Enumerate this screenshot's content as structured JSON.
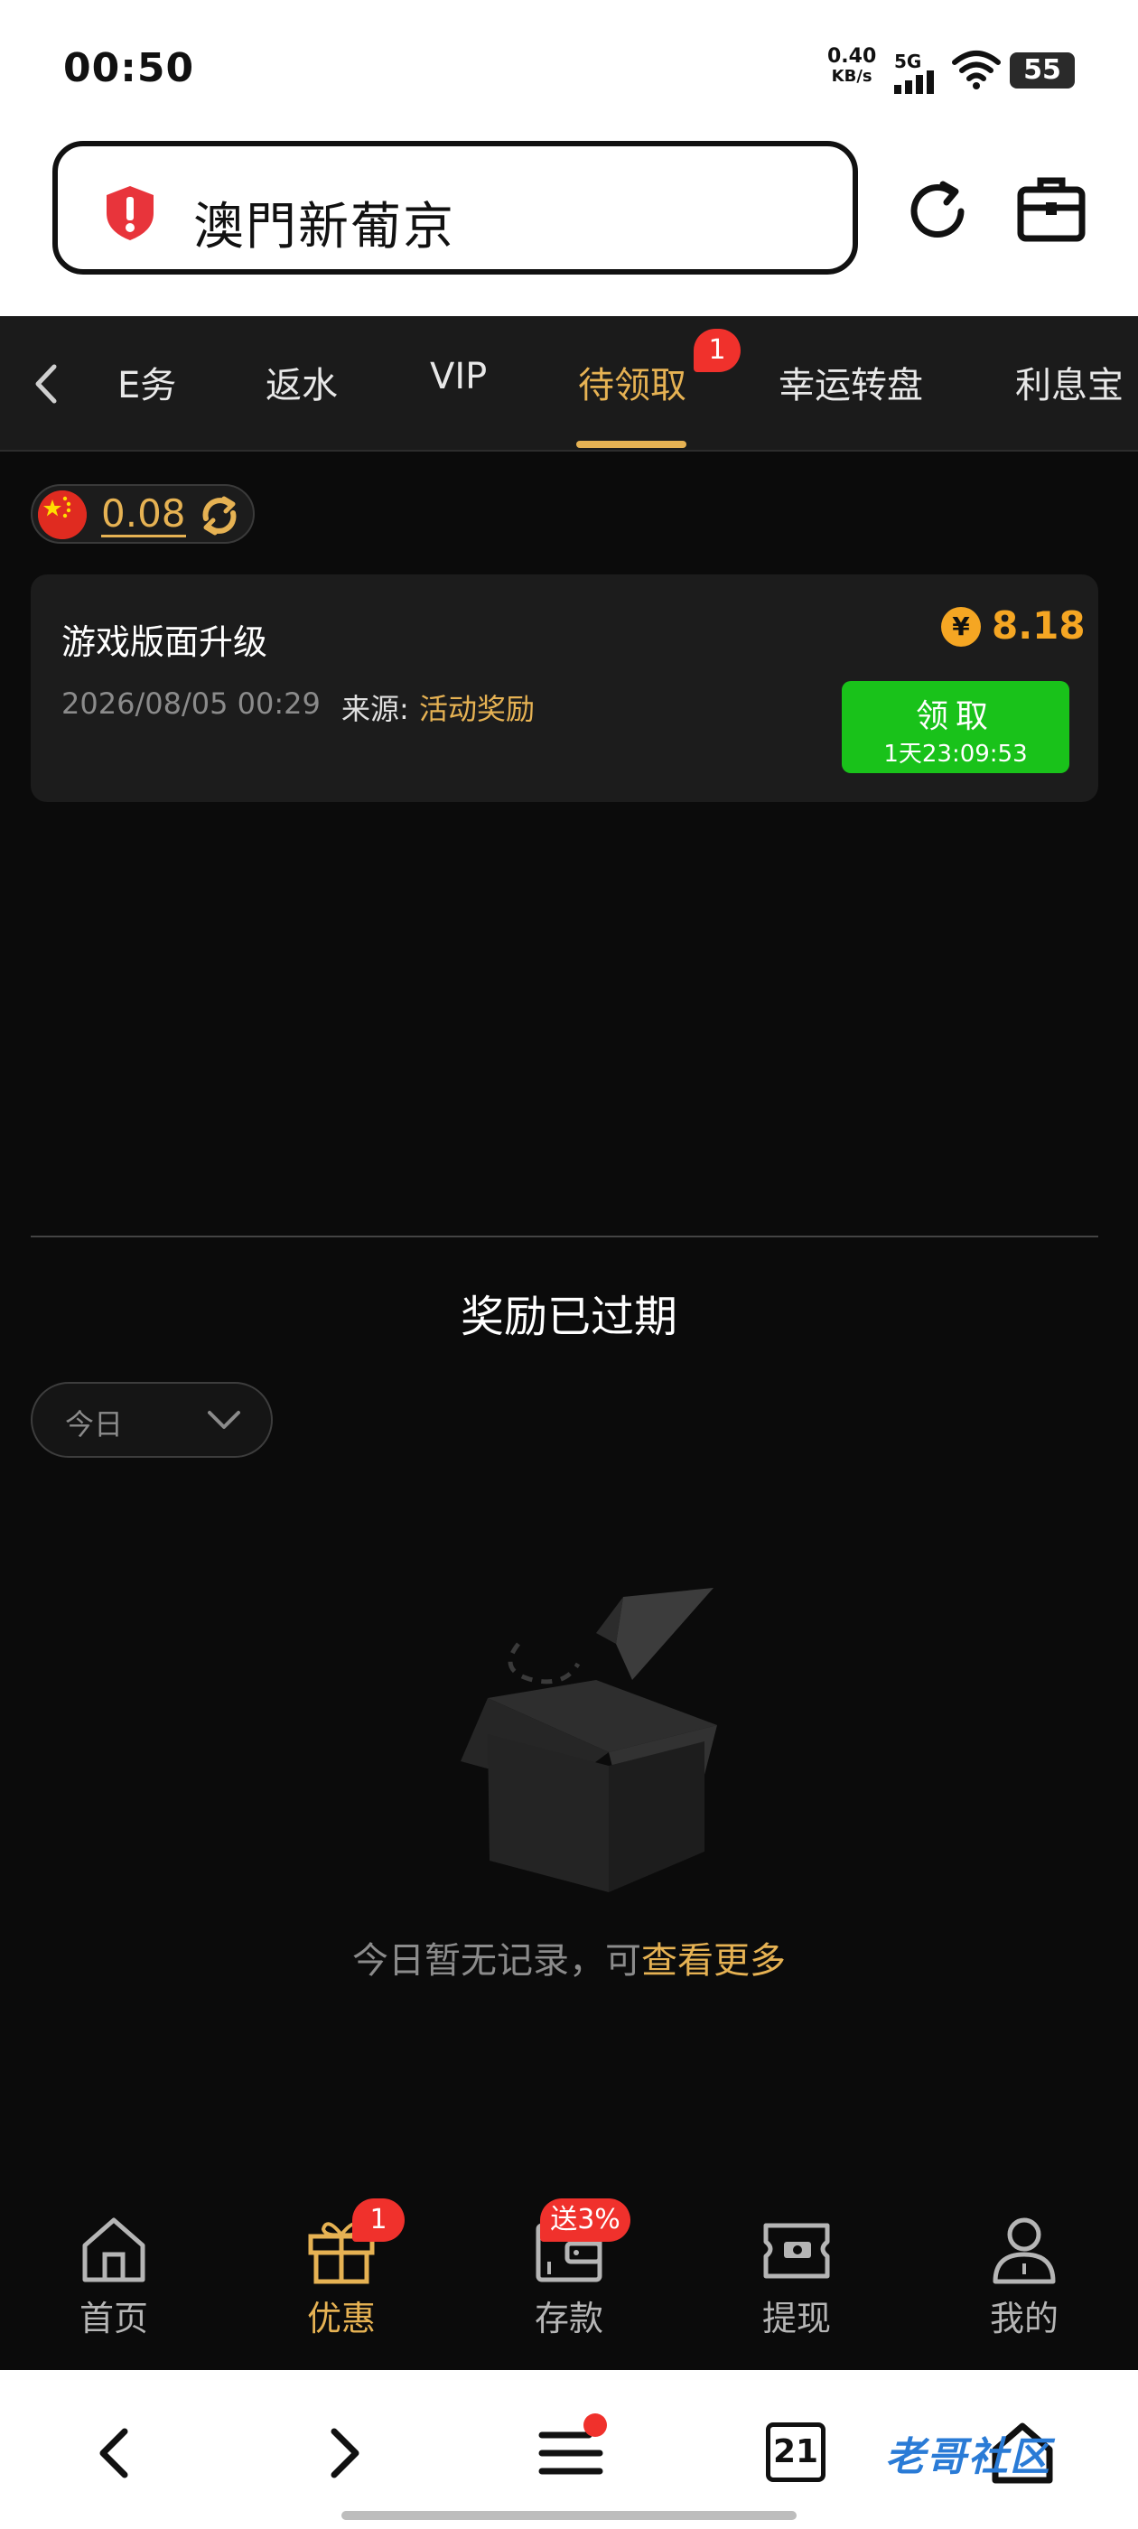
{
  "status_bar": {
    "time": "00:50",
    "net_speed_value": "0.40",
    "net_speed_unit": "KB/s",
    "network": "5G",
    "battery": "55"
  },
  "address_bar": {
    "site_title": "澳門新葡京",
    "security_icon": "shield-alert-icon"
  },
  "tabs": [
    {
      "label": "任务",
      "visible_label": "E务"
    },
    {
      "label": "返水"
    },
    {
      "label": "VIP"
    },
    {
      "label": "待领取",
      "active": true,
      "badge": "1"
    },
    {
      "label": "幸运转盘"
    },
    {
      "label": "利息宝"
    }
  ],
  "balance": {
    "value": "0.08"
  },
  "reward_card": {
    "title": "游戏版面升级",
    "datetime": "2026/08/05 00:29",
    "source_label": "来源:",
    "source": "活动奖励",
    "currency_symbol": "¥",
    "amount": "8.18",
    "claim_label": "领取",
    "countdown": "1天23:09:53"
  },
  "expired_section": {
    "title": "奖励已过期",
    "date_filter": "今日",
    "empty_text": "今日暂无记录，可",
    "empty_link": "查看更多"
  },
  "bottom_nav": [
    {
      "label": "首页",
      "icon": "home-icon"
    },
    {
      "label": "优惠",
      "icon": "gift-icon",
      "active": true,
      "badge": "1"
    },
    {
      "label": "存款",
      "icon": "wallet-icon",
      "badge": "送3%"
    },
    {
      "label": "提现",
      "icon": "cash-icon"
    },
    {
      "label": "我的",
      "icon": "user-icon"
    }
  ],
  "browser_bar": {
    "tab_count": "21",
    "watermark": "老哥社区"
  },
  "colors": {
    "accent_gold": "#e6b253",
    "claim_green": "#19c21a",
    "badge_red": "#f0312c",
    "background": "#0b0b0b",
    "card": "#1c1c1c"
  }
}
